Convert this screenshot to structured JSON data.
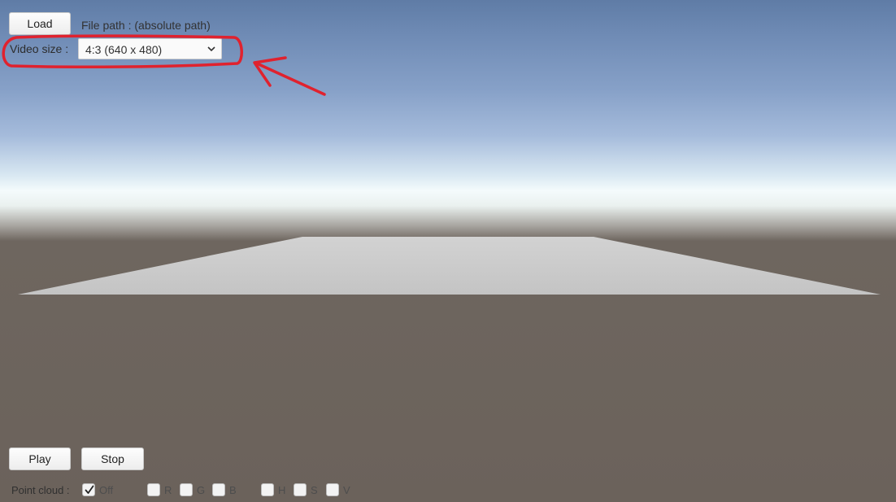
{
  "top": {
    "load_label": "Load",
    "file_path_text": "File path : (absolute path)",
    "video_size_label": "Video size :",
    "video_size_value": "4:3 (640 x 480)"
  },
  "bottom": {
    "play_label": "Play",
    "stop_label": "Stop",
    "point_cloud_label": "Point cloud :",
    "checkboxes": [
      {
        "label": "Off",
        "checked": true
      },
      {
        "label": "R",
        "checked": false
      },
      {
        "label": "G",
        "checked": false
      },
      {
        "label": "B",
        "checked": false
      },
      {
        "label": "H",
        "checked": false
      },
      {
        "label": "S",
        "checked": false
      },
      {
        "label": "V",
        "checked": false
      }
    ]
  },
  "colors": {
    "annotation": "#e0222e",
    "sky_top": "#5f7ca6",
    "ground": "#6b625b",
    "plane": "#c8c8c8"
  },
  "icons": {
    "dropdown": "chevron-down-icon",
    "check": "checkmark-icon",
    "annotation_arrow": "arrow-icon"
  }
}
